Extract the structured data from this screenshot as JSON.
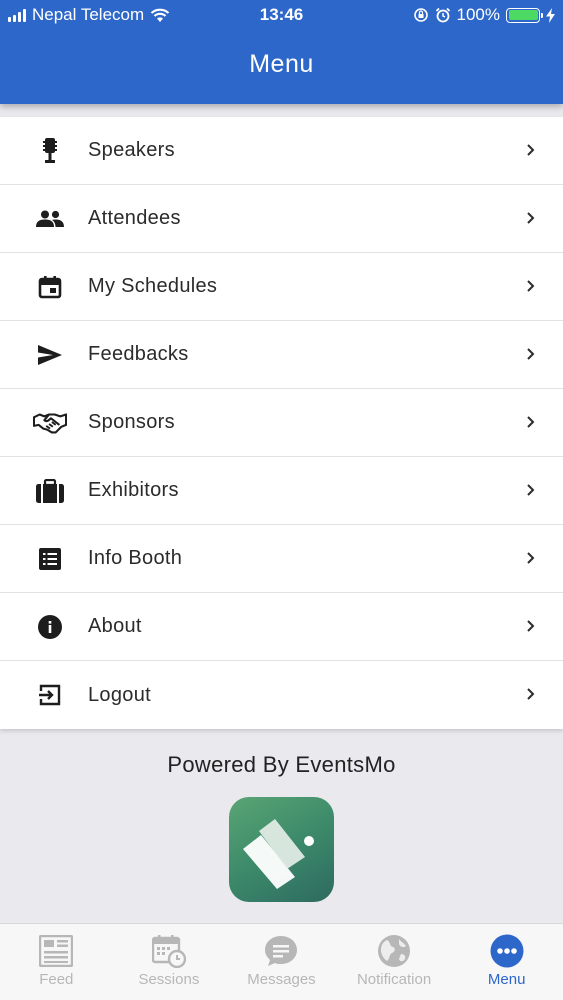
{
  "status_bar": {
    "carrier": "Nepal Telecom",
    "time": "13:46",
    "battery": "100%"
  },
  "header": {
    "title": "Menu"
  },
  "menu": {
    "items": [
      {
        "label": "Speakers",
        "icon": "microphone-icon"
      },
      {
        "label": "Attendees",
        "icon": "people-icon"
      },
      {
        "label": "My Schedules",
        "icon": "calendar-icon"
      },
      {
        "label": "Feedbacks",
        "icon": "send-icon"
      },
      {
        "label": "Sponsors",
        "icon": "handshake-icon"
      },
      {
        "label": "Exhibitors",
        "icon": "briefcase-icon"
      },
      {
        "label": "Info Booth",
        "icon": "list-icon"
      },
      {
        "label": "About",
        "icon": "info-icon"
      },
      {
        "label": "Logout",
        "icon": "logout-icon"
      }
    ]
  },
  "footer": {
    "powered_by": "Powered By EventsMo"
  },
  "tabbar": {
    "tabs": [
      {
        "label": "Feed",
        "icon": "feed-icon"
      },
      {
        "label": "Sessions",
        "icon": "sessions-icon"
      },
      {
        "label": "Messages",
        "icon": "messages-icon"
      },
      {
        "label": "Notification",
        "icon": "globe-icon"
      },
      {
        "label": "Menu",
        "icon": "more-icon"
      }
    ],
    "active": "Menu"
  },
  "colors": {
    "primary": "#2c67c9",
    "background": "#e9e9ee",
    "inactive_tab": "#b7b7b7",
    "battery": "#4cd964"
  }
}
